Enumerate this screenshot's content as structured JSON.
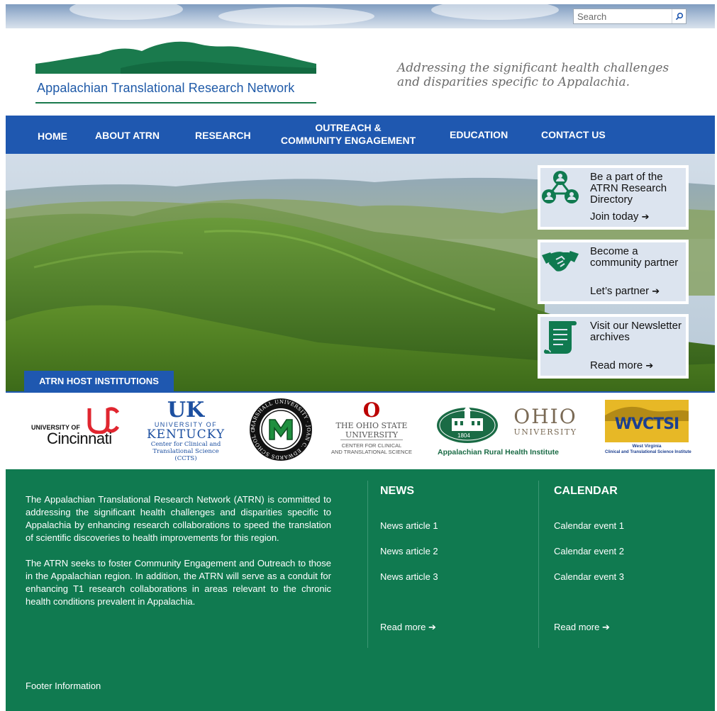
{
  "search": {
    "placeholder": "Search",
    "button_icon": "search-icon"
  },
  "header": {
    "site_name": "Appalachian Translational Research Network",
    "tagline_line1": "Addressing the significant health challenges",
    "tagline_line2": "and disparities specific to Appalachia."
  },
  "nav": {
    "items": [
      {
        "label": "HOME"
      },
      {
        "label": "ABOUT ATRN"
      },
      {
        "label": "RESEARCH"
      },
      {
        "label_line1": "OUTREACH &",
        "label_line2": "COMMUNITY ENGAGEMENT"
      },
      {
        "label": "EDUCATION"
      },
      {
        "label": "CONTACT US"
      }
    ]
  },
  "promos": [
    {
      "title": "Be a part of the ATRN Research Directory",
      "link": "Join today",
      "icon": "network-people-icon"
    },
    {
      "title": "Become a community partner",
      "link": "Let’s partner",
      "icon": "handshake-icon"
    },
    {
      "title": "Visit our Newsletter archives",
      "link": "Read more",
      "icon": "scroll-icon"
    }
  ],
  "hosts": {
    "tab_label": "ATRN HOST INSTITUTIONS",
    "cincinnati": {
      "line1": "UNIVERSITY OF",
      "line2": "Cincinnati"
    },
    "kentucky": {
      "mark": "UK",
      "line1": "UNIVERSITY OF",
      "line2": "KENTUCKY",
      "line3": "Center for Clinical and",
      "line4": "Translational Science (CCTS)"
    },
    "marshall": {
      "mark": "M",
      "ring": "MARSHALL UNIVERSITY · JOAN C. EDWARDS SCHOOL OF MEDICINE"
    },
    "ohio_state": {
      "mark": "O",
      "line1": "THE OHIO STATE",
      "line2": "UNIVERSITY",
      "line3": "CENTER FOR CLINICAL",
      "line4": "AND TRANSLATIONAL SCIENCE"
    },
    "ohio_u": {
      "year": "1804",
      "line1": "OHIO",
      "line2": "UNIVERSITY",
      "line3": "Appalachian Rural Health Institute"
    },
    "wvctsi": {
      "mark": "WVCTSI",
      "line1": "West Virginia",
      "line2": "Clinical and Translational Science Institute"
    }
  },
  "footer": {
    "about_p1": "The Appalachian Translational Research Network (ATRN) is committed to addressing the significant health challenges and disparities specific to Appalachia by enhancing research collaborations to speed the translation of scientific discoveries to health improvements for this region.",
    "about_p2": "The ATRN seeks to foster Community Engagement and Outreach to those in the Appalachian region. In addition, the ATRN will serve as a conduit for enhancing T1 research collaborations in areas relevant to the chronic health conditions prevalent in Appalachia.",
    "news": {
      "title": "NEWS",
      "items": [
        "News article 1",
        "News article 2",
        "News article 3"
      ],
      "more": "Read more"
    },
    "calendar": {
      "title": "CALENDAR",
      "items": [
        "Calendar event 1",
        "Calendar event 2",
        "Calendar event 3"
      ],
      "more": "Read more"
    },
    "info": "Footer Information"
  },
  "colors": {
    "nav_blue": "#1f58b0",
    "footer_green": "#107a50",
    "logo_green": "#1a7a4d",
    "logo_blue": "#1f5aa8",
    "promo_bg": "#dce4ef"
  }
}
